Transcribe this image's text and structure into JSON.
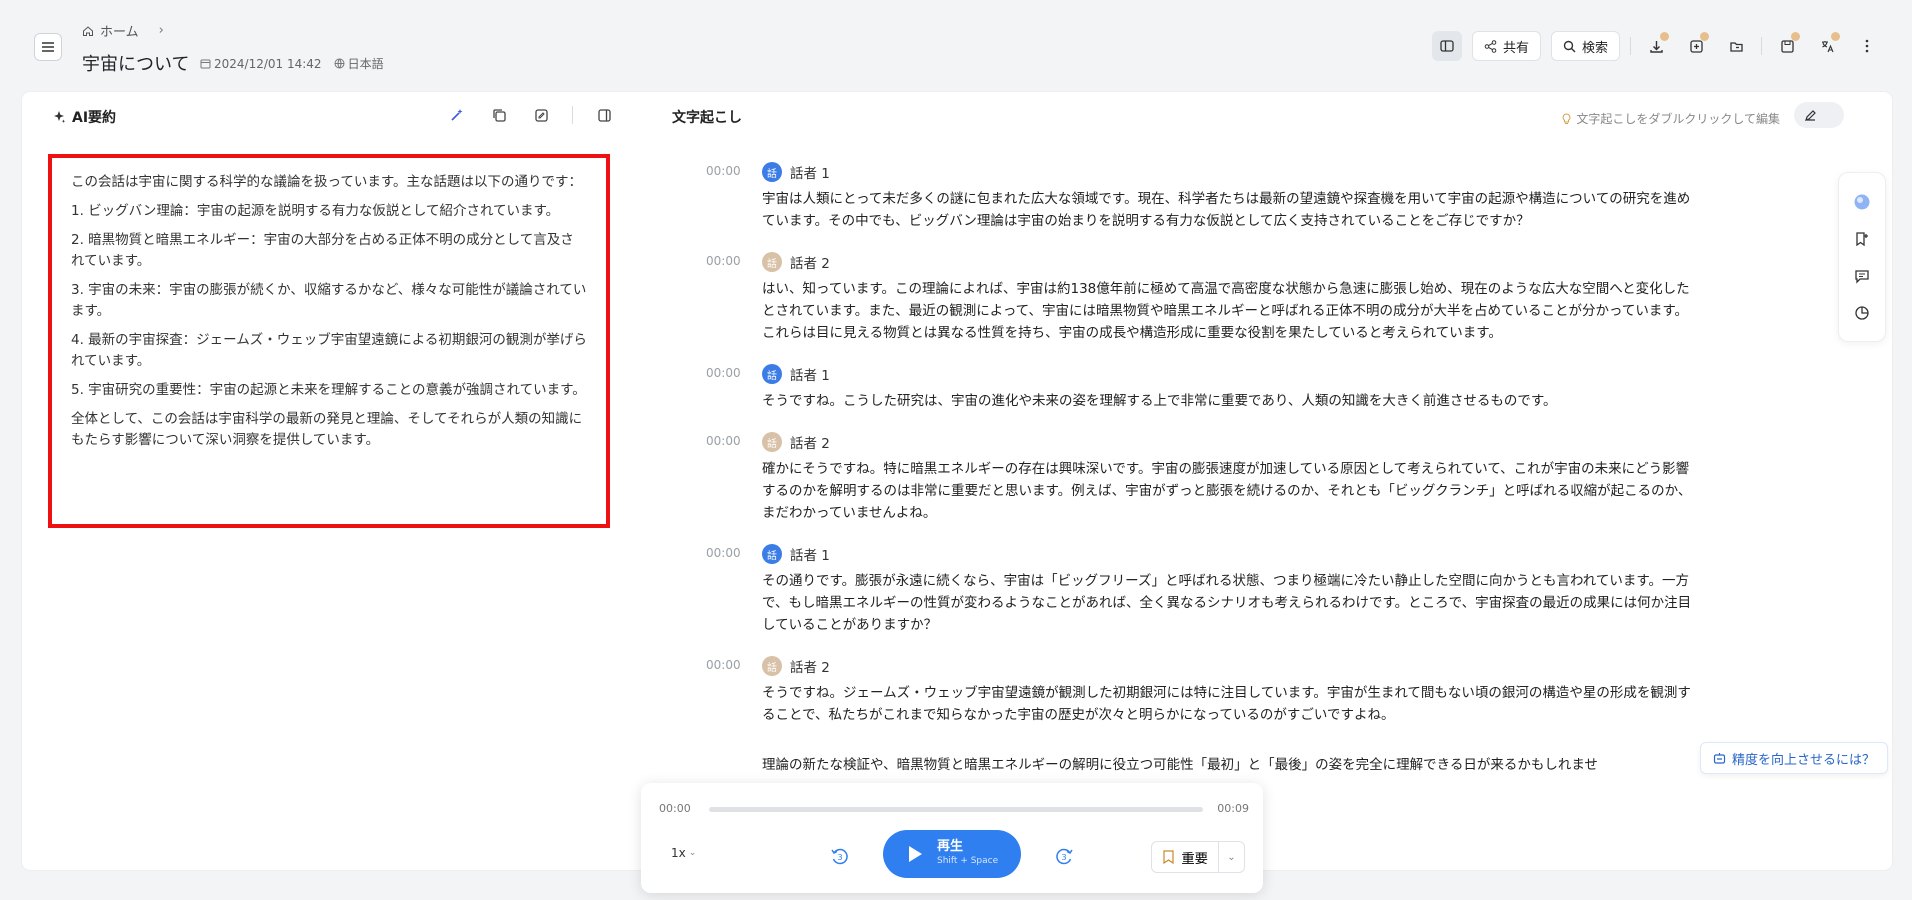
{
  "breadcrumb": {
    "home": "ホーム"
  },
  "document": {
    "title": "宇宙について",
    "date": "2024/12/01 14:42",
    "language": "日本語"
  },
  "toolbar": {
    "share": "共有",
    "search": "検索"
  },
  "summary_panel": {
    "title": "AI要約",
    "paragraphs": [
      "この会話は宇宙に関する科学的な議論を扱っています。主な話題は以下の通りです：",
      "1. ビッグバン理論：宇宙の起源を説明する有力な仮説として紹介されています。",
      "2. 暗黒物質と暗黒エネルギー：宇宙の大部分を占める正体不明の成分として言及されています。",
      "3. 宇宙の未来：宇宙の膨張が続くか、収縮するかなど、様々な可能性が議論されています。",
      "4. 最新の宇宙探査：ジェームズ・ウェッブ宇宙望遠鏡による初期銀河の観測が挙げられています。",
      "5. 宇宙研究の重要性：宇宙の起源と未来を理解することの意義が強調されています。",
      "全体として、この会話は宇宙科学の最新の発見と理論、そしてそれらが人類の知識にもたらす影響について深い洞察を提供しています。"
    ]
  },
  "transcript_panel": {
    "title": "文字起こし",
    "hint": "文字起こしをダブルクリックして編集",
    "segments": [
      {
        "time": "00:00",
        "speaker": "話者 1",
        "text": "宇宙は人類にとって未だ多くの謎に包まれた広大な領域です。現在、科学者たちは最新の望遠鏡や探査機を用いて宇宙の起源や構造についての研究を進めています。その中でも、ビッグバン理論は宇宙の始まりを説明する有力な仮説として広く支持されていることをご存じですか？"
      },
      {
        "time": "00:00",
        "speaker": "話者 2",
        "text": "はい、知っています。この理論によれば、宇宙は約138億年前に極めて高温で高密度な状態から急速に膨張し始め、現在のような広大な空間へと変化したとされています。また、最近の観測によって、宇宙には暗黒物質や暗黒エネルギーと呼ばれる正体不明の成分が大半を占めていることが分かっています。これらは目に見える物質とは異なる性質を持ち、宇宙の成長や構造形成に重要な役割を果たしていると考えられています。"
      },
      {
        "time": "00:00",
        "speaker": "話者 1",
        "text": "そうですね。こうした研究は、宇宙の進化や未来の姿を理解する上で非常に重要であり、人類の知識を大きく前進させるものです。"
      },
      {
        "time": "00:00",
        "speaker": "話者 2",
        "text": "確かにそうですね。特に暗黒エネルギーの存在は興味深いです。宇宙の膨張速度が加速している原因として考えられていて、これが宇宙の未来にどう影響するのかを解明するのは非常に重要だと思います。例えば、宇宙がずっと膨張を続けるのか、それとも「ビッグクランチ」と呼ばれる収縮が起こるのか、まだわかっていませんよね。"
      },
      {
        "time": "00:00",
        "speaker": "話者 1",
        "text": "その通りです。膨張が永遠に続くなら、宇宙は「ビッグフリーズ」と呼ばれる状態、つまり極端に冷たい静止した空間に向かうとも言われています。一方で、もし暗黒エネルギーの性質が変わるようなことがあれば、全く異なるシナリオも考えられるわけです。ところで、宇宙探査の最近の成果には何か注目していることがありますか？"
      },
      {
        "time": "00:00",
        "speaker": "話者 2",
        "text": "そうですね。ジェームズ・ウェッブ宇宙望遠鏡が観測した初期銀河には特に注目しています。宇宙が生まれて間もない頃の銀河の構造や星の形成を観測することで、私たちがこれまで知らなかった宇宙の歴史が次々と明らかになっているのがすごいですよね。"
      },
      {
        "time": "",
        "speaker": "",
        "text": "理論の新たな検証や、暗黒物質と暗黒エネルギーの解明に役立つ可能性「最初」と「最後」の姿を完全に理解できる日が来るかもしれませ"
      }
    ]
  },
  "help_link": "精度を向上させるには？",
  "player": {
    "current_time": "00:00",
    "duration": "00:09",
    "progress": 0,
    "speed": "1x",
    "play_label": "再生",
    "play_shortcut": "Shift + Space",
    "important_label": "重要",
    "skip_back": "3",
    "skip_forward": "3"
  }
}
